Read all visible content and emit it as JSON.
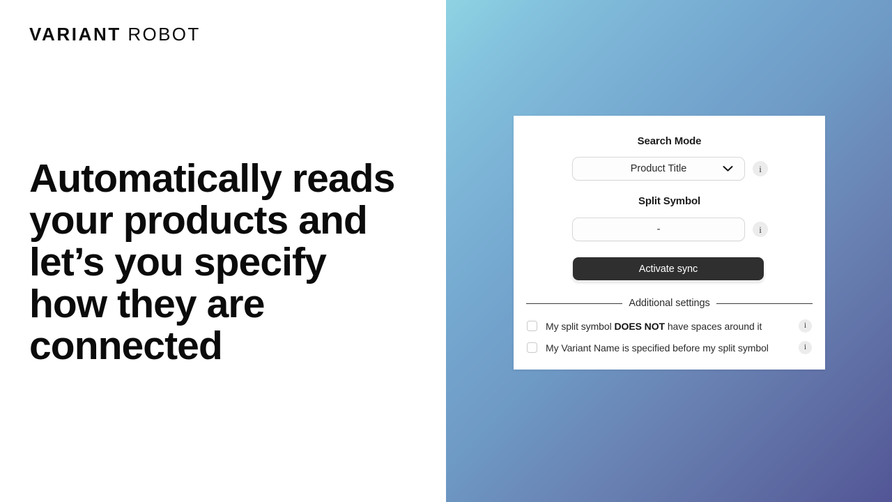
{
  "brand": {
    "strong": "VARIANT",
    "light": "ROBOT"
  },
  "headline": "Automatically reads your products and let’s you specify how they are connected",
  "card": {
    "search_mode": {
      "label": "Search Mode",
      "value": "Product Title",
      "options": [
        "Product Title"
      ],
      "chevron_icon": "chevron-down-icon",
      "info_icon": "i",
      "info_label": "info-icon"
    },
    "split_symbol": {
      "label": "Split Symbol",
      "value": "-",
      "placeholder": "-",
      "info_icon": "i",
      "info_label": "info-icon"
    },
    "activate_button": "Activate sync",
    "additional_settings_label": "Additional settings",
    "checkboxes": [
      {
        "text_before": "My split symbol ",
        "text_bold": "DOES NOT",
        "text_after": " have spaces around it",
        "full_text": "My split symbol DOES NOT have spaces around it",
        "checked": false,
        "info_icon": "i"
      },
      {
        "text_before": "My Variant Name is specified before my split symbol",
        "text_bold": "",
        "text_after": "",
        "full_text": "My Variant Name is specified before my split symbol",
        "checked": false,
        "info_icon": "i"
      }
    ]
  },
  "colors": {
    "gradient_start": "#8ed3e3",
    "gradient_end": "#525596",
    "button_bg": "#2f2f2f",
    "card_bg": "#ffffff",
    "info_badge_bg": "#ececec",
    "text_primary": "#0b0b0b"
  }
}
